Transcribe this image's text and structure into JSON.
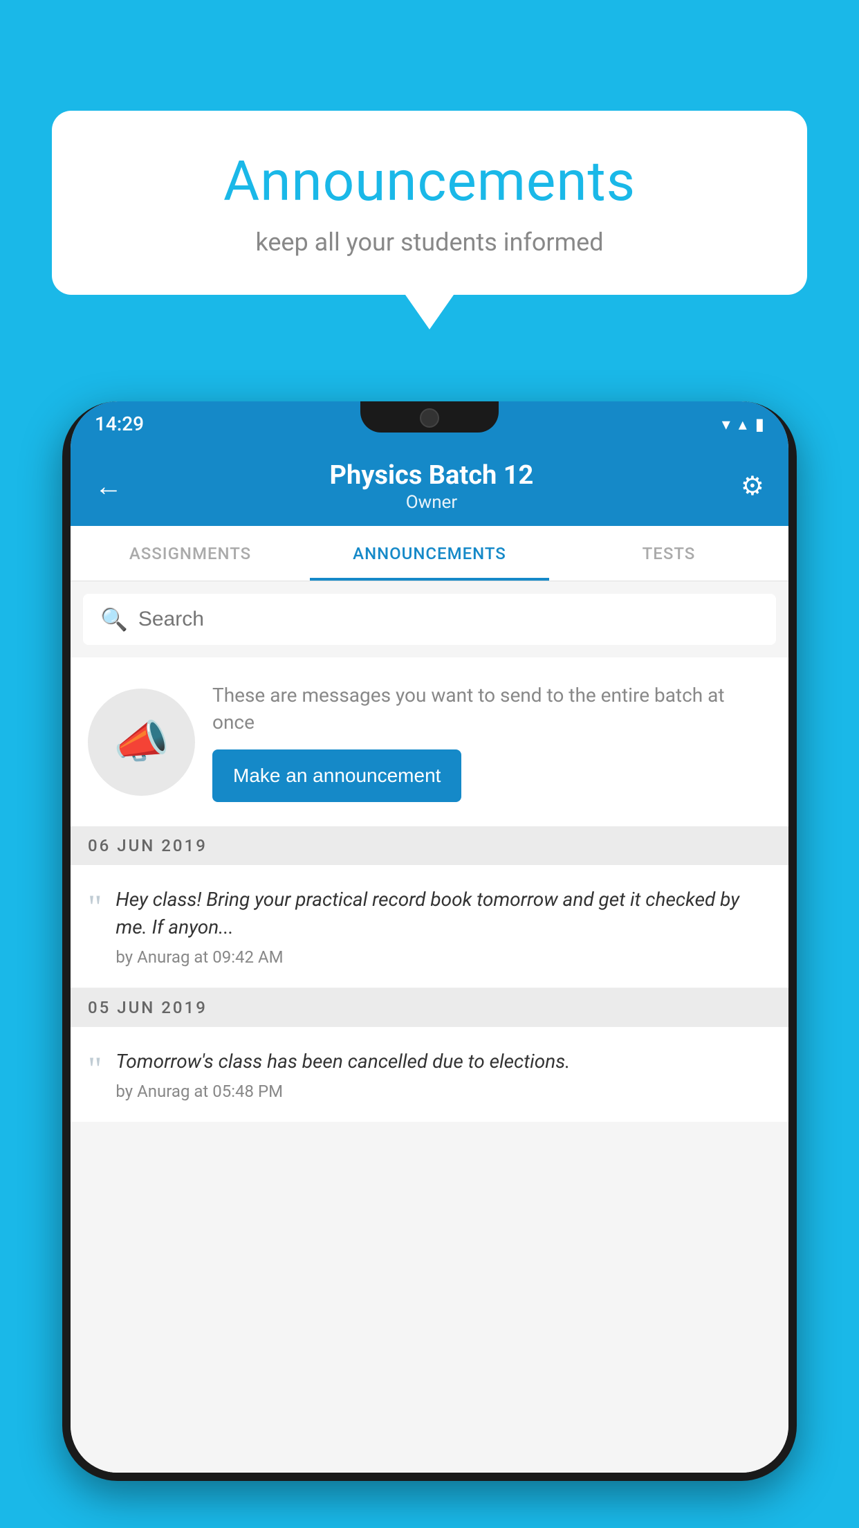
{
  "speech_bubble": {
    "title": "Announcements",
    "subtitle": "keep all your students informed"
  },
  "status_bar": {
    "time": "14:29",
    "wifi": "▼",
    "signal": "▲",
    "battery": "▮"
  },
  "header": {
    "title": "Physics Batch 12",
    "subtitle": "Owner",
    "back_label": "←",
    "settings_label": "⚙"
  },
  "tabs": [
    {
      "id": "assignments",
      "label": "ASSIGNMENTS",
      "active": false
    },
    {
      "id": "announcements",
      "label": "ANNOUNCEMENTS",
      "active": true
    },
    {
      "id": "tests",
      "label": "TESTS",
      "active": false
    }
  ],
  "search": {
    "placeholder": "Search"
  },
  "promo": {
    "description": "These are messages you want to send to the entire batch at once",
    "button_label": "Make an announcement"
  },
  "announcements": [
    {
      "date": "06  JUN  2019",
      "text": "Hey class! Bring your practical record book tomorrow and get it checked by me. If anyon...",
      "meta": "by Anurag at 09:42 AM"
    },
    {
      "date": "05  JUN  2019",
      "text": "Tomorrow's class has been cancelled due to elections.",
      "meta": "by Anurag at 05:48 PM"
    }
  ],
  "colors": {
    "primary": "#1589c8",
    "background": "#1ab8e8",
    "white": "#ffffff",
    "gray_bg": "#ebebeb",
    "text_dark": "#333333",
    "text_gray": "#888888"
  }
}
